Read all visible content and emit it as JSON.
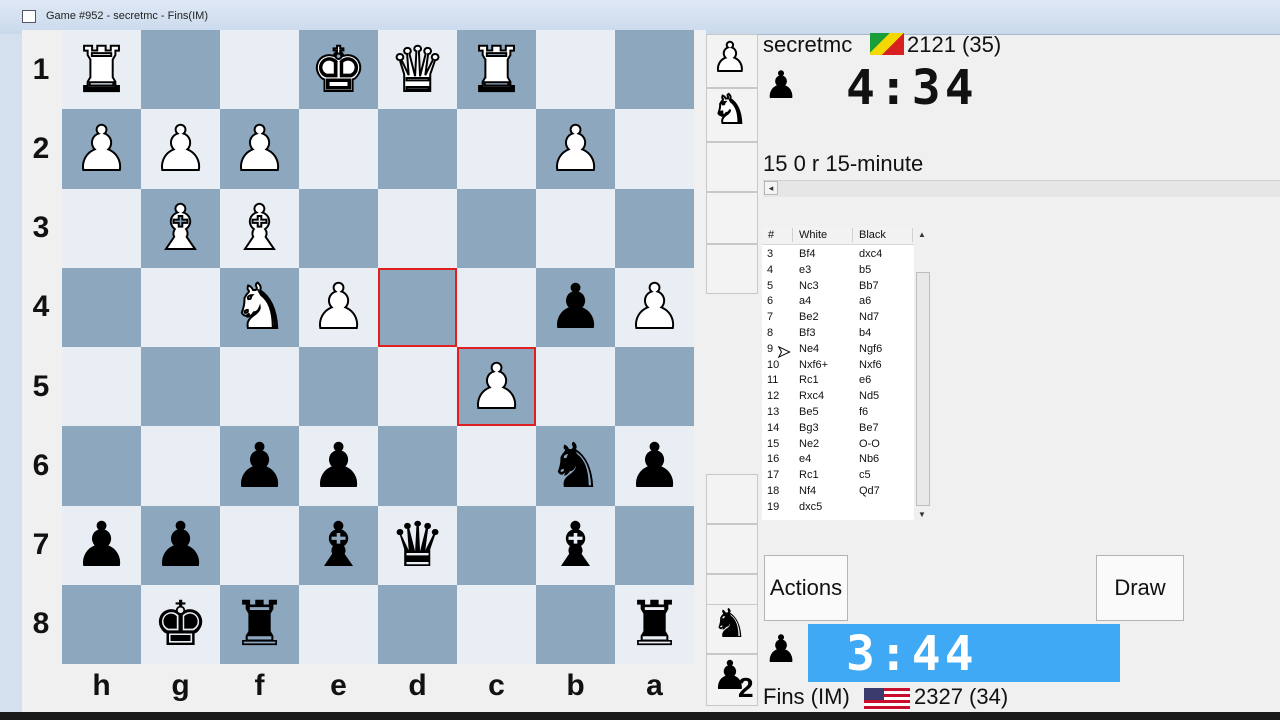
{
  "window": {
    "title": "Game #952 - secretmc - Fins(IM)"
  },
  "board": {
    "ranks": [
      "1",
      "2",
      "3",
      "4",
      "5",
      "6",
      "7",
      "8"
    ],
    "files": [
      "h",
      "g",
      "f",
      "e",
      "d",
      "c",
      "b",
      "a"
    ],
    "highlight_squares": [
      "d4",
      "c5"
    ],
    "grid": [
      [
        "wR",
        "",
        "",
        "wK",
        "wQ",
        "wR",
        "",
        ""
      ],
      [
        "wP",
        "wP",
        "wP",
        "",
        "",
        "",
        "wP",
        ""
      ],
      [
        "",
        "wB",
        "wB",
        "",
        "",
        "",
        "",
        ""
      ],
      [
        "",
        "",
        "wN",
        "wP",
        "",
        "",
        "bP",
        "wP"
      ],
      [
        "",
        "",
        "",
        "",
        "",
        "wP",
        "",
        ""
      ],
      [
        "",
        "",
        "bP",
        "bP",
        "",
        "",
        "bN",
        "bP"
      ],
      [
        "bP",
        "bP",
        "",
        "bB",
        "bQ",
        "",
        "bB",
        ""
      ],
      [
        "",
        "bK",
        "bR",
        "",
        "",
        "",
        "",
        "bR"
      ]
    ]
  },
  "captured": {
    "top": [
      "wP",
      "wN"
    ],
    "bottom": [
      "bN",
      "bP"
    ],
    "bottom_count": "2"
  },
  "top_player": {
    "name": "secretmc",
    "rating": "2121 (35)",
    "clock": "4:34",
    "icon": "player-silhouette-icon"
  },
  "game_type": "15 0 r 15-minute",
  "movelist": {
    "headers": [
      "#",
      "White",
      "Black"
    ],
    "rows": [
      [
        "3",
        "Bf4",
        "dxc4"
      ],
      [
        "4",
        "e3",
        "b5"
      ],
      [
        "5",
        "Nc3",
        "Bb7"
      ],
      [
        "6",
        "a4",
        "a6"
      ],
      [
        "7",
        "Be2",
        "Nd7"
      ],
      [
        "8",
        "Bf3",
        "b4"
      ],
      [
        "9",
        "Ne4",
        "Ngf6"
      ],
      [
        "10",
        "Nxf6+",
        "Nxf6"
      ],
      [
        "11",
        "Rc1",
        "e6"
      ],
      [
        "12",
        "Rxc4",
        "Nd5"
      ],
      [
        "13",
        "Be5",
        "f6"
      ],
      [
        "14",
        "Bg3",
        "Be7"
      ],
      [
        "15",
        "Ne2",
        "O-O"
      ],
      [
        "16",
        "e4",
        "Nb6"
      ],
      [
        "17",
        "Rc1",
        "c5"
      ],
      [
        "18",
        "Nf4",
        "Qd7"
      ],
      [
        "19",
        "dxc5",
        ""
      ]
    ]
  },
  "buttons": {
    "actions": "Actions",
    "draw": "Draw"
  },
  "bottom_player": {
    "name": "Fins (IM)",
    "rating": "2327 (34)",
    "clock": "3:44",
    "icon": "player-silhouette-icon"
  },
  "colors": {
    "clock_active": "#3fa9f5",
    "board_dark": "#8da7bf",
    "board_light": "#e8eef4",
    "highlight": "#e02020"
  }
}
